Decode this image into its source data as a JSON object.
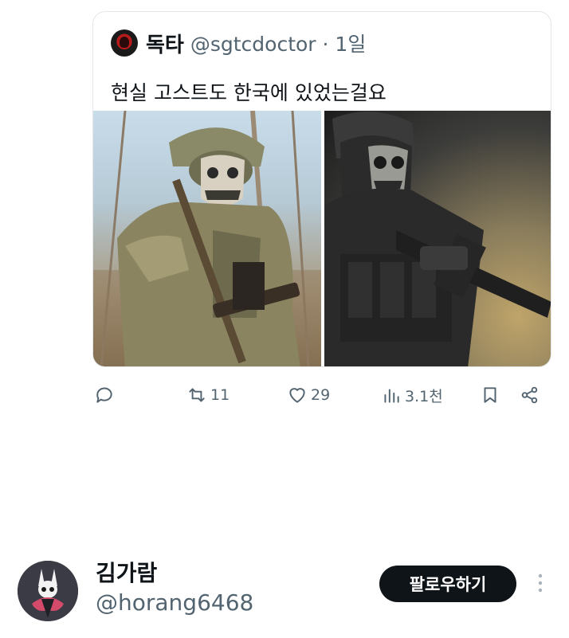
{
  "quote_tweet": {
    "author_name": "독타",
    "author_handle": "@sgtcdoctor · 1일",
    "text": "현실 고스트도 한국에 있었는걸요"
  },
  "actions": {
    "reply_count": "",
    "retweet_count": "11",
    "like_count": "29",
    "views_count": "3.1천"
  },
  "profile": {
    "name": "김가람",
    "handle": "@horang6468",
    "follow_label": "팔로우하기"
  },
  "icons": [
    "reply-icon",
    "retweet-icon",
    "like-icon",
    "views-icon",
    "bookmark-icon",
    "share-icon",
    "more-icon"
  ],
  "colors": {
    "text": "#0f1419",
    "secondary": "#536471",
    "button_bg": "#0f1419",
    "border": "#e3e6e8"
  }
}
